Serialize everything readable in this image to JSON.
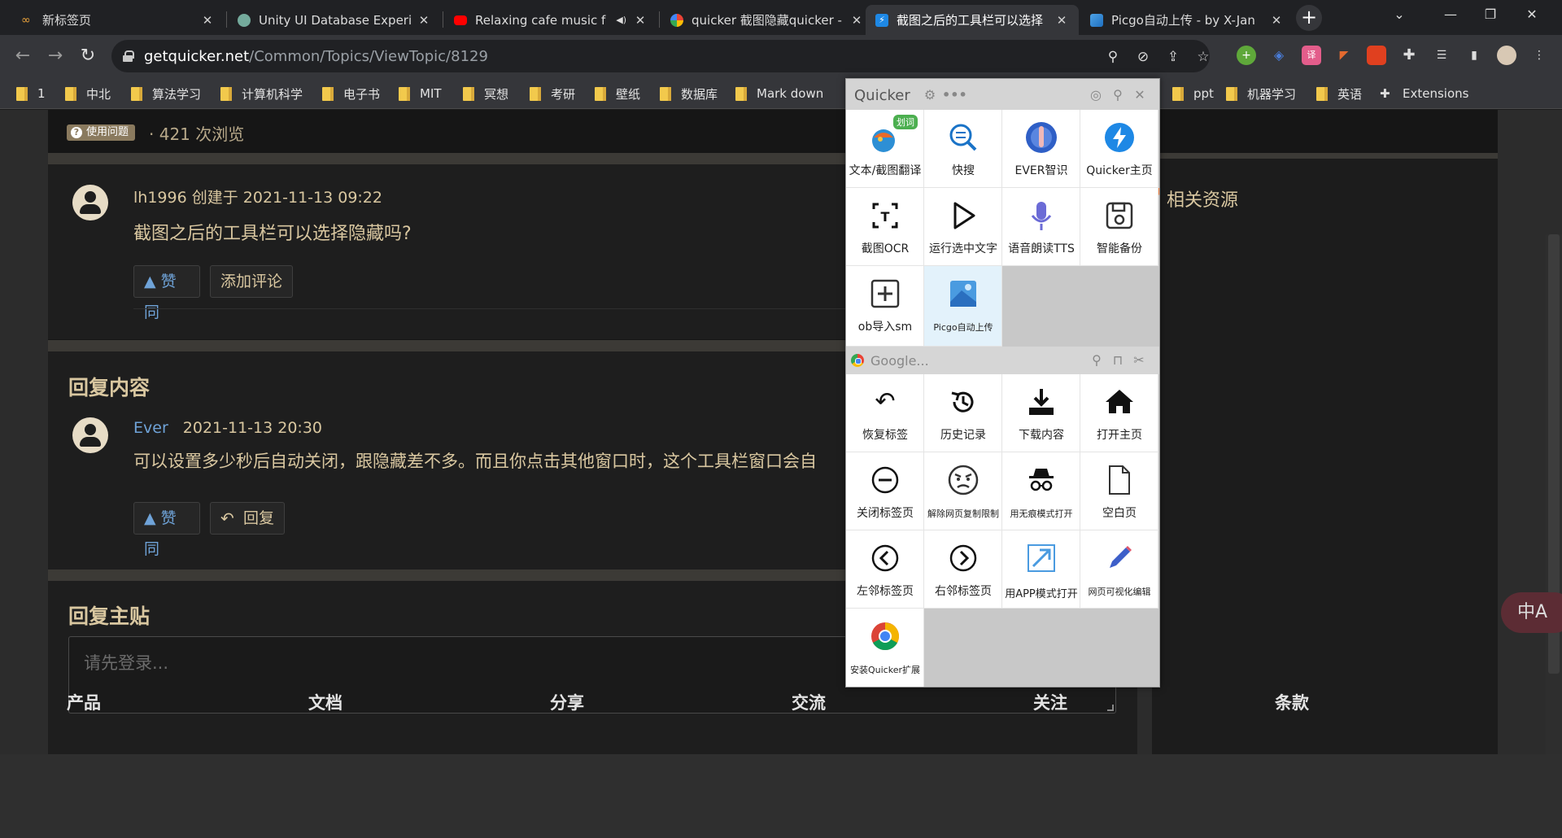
{
  "browser": {
    "tabs": [
      {
        "title": "新标签页",
        "active": false
      },
      {
        "title": "Unity UI Database Experi",
        "active": false
      },
      {
        "title": "Relaxing cafe music f",
        "active": false
      },
      {
        "title": "quicker 截图隐藏quicker -",
        "active": false
      },
      {
        "title": "截图之后的工具栏可以选择",
        "active": true
      },
      {
        "title": "Picgo自动上传 - by X-Jan",
        "active": false
      }
    ],
    "url_host": "getquicker.net",
    "url_path": "/Common/Topics/ViewTopic/8129",
    "bookmarks": [
      "1",
      "中北",
      "算法学习",
      "计算机科学",
      "电子书",
      "MIT",
      "冥想",
      "考研",
      "壁纸",
      "数据库",
      "Mark down",
      "ppt",
      "机器学习",
      "英语",
      "Extensions"
    ]
  },
  "topic": {
    "badge": "使用问题",
    "views": "· 421 次浏览",
    "author": "lh1996",
    "created": "创建于 2021-11-13 09:22",
    "title": "截图之后的工具栏可以选择隐藏吗?",
    "like_label": "▲ 赞同",
    "comment_label": "添加评论"
  },
  "reply_section": {
    "heading": "回复内容",
    "author": "Ever",
    "time": "2021-11-13 20:30",
    "text": "可以设置多少秒后自动关闭，跟隐藏差不多。而且你点击其他窗口时，这个工具栏窗口会自",
    "like_label": "▲ 赞同",
    "reply_label": "回复"
  },
  "reply_main": {
    "heading": "回复主贴",
    "placeholder": "请先登录..."
  },
  "sidebar": {
    "related": "相关资源"
  },
  "footer": [
    "产品",
    "文档",
    "分享",
    "交流",
    "关注",
    "条款"
  ],
  "translate_fab": "中A",
  "quicker": {
    "title": "Quicker",
    "top_actions": [
      {
        "label": "文本/截图翻译",
        "icon": "translate-icon",
        "tag": "划词"
      },
      {
        "label": "快搜",
        "icon": "quick-search-icon"
      },
      {
        "label": "EVER智识",
        "icon": "ever-icon"
      },
      {
        "label": "Quicker主页",
        "icon": "lightning-icon"
      },
      {
        "label": "截图OCR",
        "icon": "ocr-icon"
      },
      {
        "label": "运行选中文字",
        "icon": "play-icon"
      },
      {
        "label": "语音朗读TTS",
        "icon": "microphone-icon"
      },
      {
        "label": "智能备份",
        "icon": "save-icon"
      },
      {
        "label": "ob导入sm",
        "icon": "plus-box-icon"
      },
      {
        "label": "Picgo自动上传",
        "icon": "picgo-icon"
      }
    ],
    "context_label": "Google...",
    "context_actions": [
      {
        "label": "恢复标签",
        "icon": "undo-icon"
      },
      {
        "label": "历史记录",
        "icon": "history-icon"
      },
      {
        "label": "下载内容",
        "icon": "download-icon"
      },
      {
        "label": "打开主页",
        "icon": "home-icon"
      },
      {
        "label": "关闭标签页",
        "icon": "minus-circle-icon"
      },
      {
        "label": "解除网页复制限制",
        "icon": "angry-face-icon"
      },
      {
        "label": "用无痕模式打开",
        "icon": "incognito-icon"
      },
      {
        "label": "空白页",
        "icon": "blank-page-icon"
      },
      {
        "label": "左邻标签页",
        "icon": "left-circle-icon"
      },
      {
        "label": "右邻标签页",
        "icon": "right-circle-icon"
      },
      {
        "label": "用APP模式打开",
        "icon": "app-mode-icon"
      },
      {
        "label": "网页可视化编辑",
        "icon": "pencil-icon"
      },
      {
        "label": "安装Quicker扩展",
        "icon": "chrome-icon"
      }
    ]
  }
}
